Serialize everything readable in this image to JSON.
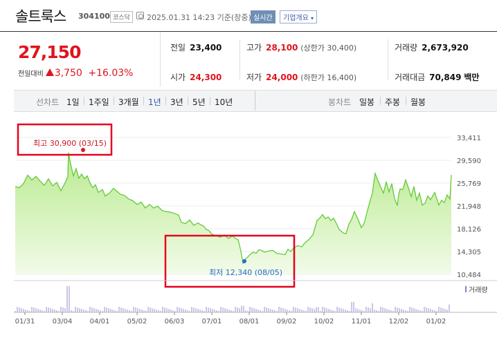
{
  "header": {
    "stock_name": "솔트룩스",
    "stock_code": "304100",
    "market": "코스닥",
    "datetime": "2025.01.31 14:23 기준(장중)",
    "realtime_btn": "실시간",
    "company_btn": "기업개요"
  },
  "price": {
    "current": "27,150",
    "change_label": "전일대비",
    "change": "3,750",
    "change_pct": "+16.03%"
  },
  "stats": {
    "prev_label": "전일",
    "prev": "23,400",
    "high_label": "고가",
    "high": "28,100",
    "high_note": "(상한가 30,400)",
    "volume_label": "거래량",
    "volume": "2,673,920",
    "open_label": "시가",
    "open": "24,300",
    "low_label": "저가",
    "low": "24,000",
    "low_note": "(하한가 16,400)",
    "amount_label": "거래대금",
    "amount": "70,849",
    "amount_unit": "백만"
  },
  "tabs": {
    "line_chart_label": "선차트",
    "periods": [
      "1일",
      "1주일",
      "3개월",
      "1년",
      "3년",
      "5년",
      "10년"
    ],
    "active_period": "1년",
    "candle_chart_label": "봉차트",
    "candle_periods": [
      "일봉",
      "주봉",
      "월봉"
    ]
  },
  "chart_data": {
    "type": "area",
    "y_ticks": [
      "33,411",
      "29,590",
      "25,769",
      "21,948",
      "18,126",
      "14,305",
      "10,484"
    ],
    "ylim": [
      10484,
      33411
    ],
    "x_ticks": [
      "01/31",
      "03/04",
      "04/01",
      "05/02",
      "06/03",
      "07/01",
      "08/01",
      "09/02",
      "10/02",
      "11/01",
      "12/02",
      "01/02"
    ],
    "volume_label": "거래량",
    "max_annotation": "최고 30,900 (03/15)",
    "min_annotation": "최저 12,340 (08/05)",
    "max_point": {
      "x": 77,
      "y": 30900
    },
    "min_point": {
      "x": 329,
      "y": 12340
    },
    "n_points": 630,
    "series": [
      {
        "values": [
          [
            0,
            25200
          ],
          [
            6,
            25000
          ],
          [
            12,
            25700
          ],
          [
            18,
            27100
          ],
          [
            24,
            26300
          ],
          [
            30,
            26900
          ],
          [
            36,
            26100
          ],
          [
            42,
            25400
          ],
          [
            48,
            26500
          ],
          [
            54,
            25300
          ],
          [
            60,
            25900
          ],
          [
            66,
            24500
          ],
          [
            72,
            25800
          ],
          [
            76,
            26900
          ],
          [
            77,
            30900
          ],
          [
            80,
            29000
          ],
          [
            84,
            27000
          ],
          [
            88,
            28200
          ],
          [
            92,
            26600
          ],
          [
            96,
            27300
          ],
          [
            100,
            26500
          ],
          [
            104,
            27000
          ],
          [
            108,
            25800
          ],
          [
            112,
            25000
          ],
          [
            116,
            25500
          ],
          [
            120,
            24200
          ],
          [
            126,
            24700
          ],
          [
            130,
            23600
          ],
          [
            136,
            24100
          ],
          [
            142,
            24900
          ],
          [
            148,
            24300
          ],
          [
            152,
            23900
          ],
          [
            158,
            23700
          ],
          [
            164,
            23100
          ],
          [
            170,
            22800
          ],
          [
            176,
            22200
          ],
          [
            182,
            22600
          ],
          [
            188,
            21600
          ],
          [
            194,
            22200
          ],
          [
            200,
            21600
          ],
          [
            206,
            21900
          ],
          [
            212,
            21200
          ],
          [
            218,
            21000
          ],
          [
            224,
            20900
          ],
          [
            230,
            20700
          ],
          [
            236,
            20400
          ],
          [
            240,
            19200
          ],
          [
            246,
            19000
          ],
          [
            252,
            19600
          ],
          [
            258,
            18700
          ],
          [
            264,
            19100
          ],
          [
            268,
            18800
          ],
          [
            272,
            18600
          ],
          [
            276,
            18000
          ],
          [
            280,
            17800
          ],
          [
            284,
            17200
          ],
          [
            290,
            17000
          ],
          [
            296,
            16700
          ],
          [
            302,
            17100
          ],
          [
            308,
            16500
          ],
          [
            314,
            16900
          ],
          [
            318,
            16500
          ],
          [
            322,
            16300
          ],
          [
            326,
            14400
          ],
          [
            329,
            12340
          ],
          [
            332,
            13000
          ],
          [
            336,
            13400
          ],
          [
            340,
            13900
          ],
          [
            344,
            14200
          ],
          [
            348,
            14000
          ],
          [
            352,
            14600
          ],
          [
            356,
            14500
          ],
          [
            360,
            14200
          ],
          [
            366,
            14400
          ],
          [
            372,
            14500
          ],
          [
            378,
            14000
          ],
          [
            384,
            13900
          ],
          [
            390,
            13800
          ],
          [
            394,
            14700
          ],
          [
            398,
            14300
          ],
          [
            402,
            14900
          ],
          [
            408,
            15300
          ],
          [
            414,
            15100
          ],
          [
            418,
            15700
          ],
          [
            424,
            16300
          ],
          [
            430,
            17100
          ],
          [
            436,
            19500
          ],
          [
            440,
            19900
          ],
          [
            444,
            20500
          ],
          [
            448,
            19800
          ],
          [
            452,
            20100
          ],
          [
            456,
            19500
          ],
          [
            460,
            19900
          ],
          [
            464,
            19000
          ],
          [
            468,
            18000
          ],
          [
            474,
            17400
          ],
          [
            478,
            17300
          ],
          [
            482,
            18900
          ],
          [
            486,
            19700
          ],
          [
            490,
            21000
          ],
          [
            496,
            19500
          ],
          [
            500,
            18300
          ],
          [
            504,
            19000
          ],
          [
            508,
            20800
          ],
          [
            512,
            22500
          ],
          [
            516,
            24100
          ],
          [
            518,
            25800
          ],
          [
            520,
            27400
          ],
          [
            524,
            26200
          ],
          [
            528,
            25100
          ],
          [
            532,
            24100
          ],
          [
            536,
            26000
          ],
          [
            540,
            24300
          ],
          [
            544,
            25700
          ],
          [
            548,
            23200
          ],
          [
            552,
            22000
          ],
          [
            554,
            23900
          ],
          [
            556,
            24800
          ],
          [
            560,
            24700
          ],
          [
            564,
            26300
          ],
          [
            568,
            25000
          ],
          [
            572,
            23500
          ],
          [
            576,
            25200
          ],
          [
            580,
            22900
          ],
          [
            584,
            24100
          ],
          [
            588,
            22100
          ],
          [
            592,
            22400
          ],
          [
            596,
            23600
          ],
          [
            600,
            23000
          ],
          [
            606,
            24200
          ],
          [
            612,
            22100
          ],
          [
            616,
            22900
          ],
          [
            620,
            22500
          ],
          [
            624,
            23800
          ],
          [
            628,
            23100
          ],
          [
            630,
            27150
          ]
        ]
      }
    ],
    "volume_spikes": [
      [
        77,
        1.0
      ],
      [
        329,
        0.25
      ],
      [
        436,
        0.2
      ],
      [
        488,
        0.4
      ],
      [
        516,
        0.35
      ],
      [
        628,
        0.3
      ]
    ],
    "colors": {
      "line": "#66c93a",
      "fill_top": "#b8ea8e",
      "fill_bottom": "#f2fbe9",
      "up": "#e0141e",
      "annotation_box": "#e6001f",
      "min_text": "#2a6ac9"
    }
  }
}
